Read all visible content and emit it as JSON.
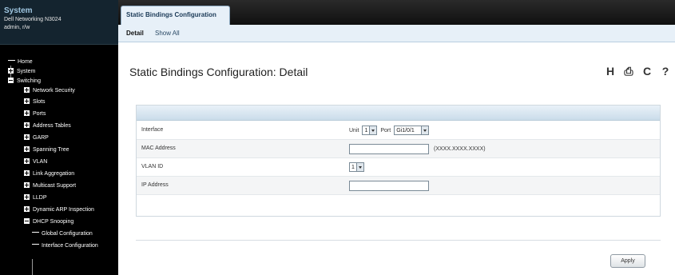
{
  "sidebar": {
    "title": "System",
    "device": "Dell Networking N3024",
    "user": "admin, r/w",
    "tree": [
      {
        "label": "Home",
        "icon": "home-icon"
      },
      {
        "label": "System",
        "icon": "expand-plus-icon"
      },
      {
        "label": "Switching",
        "icon": "collapse-minus-icon"
      },
      {
        "label": "Network Security",
        "icon": "expand-plus-icon"
      },
      {
        "label": "Slots",
        "icon": "expand-plus-icon"
      },
      {
        "label": "Ports",
        "icon": "expand-plus-icon"
      },
      {
        "label": "Address Tables",
        "icon": "expand-plus-icon"
      },
      {
        "label": "GARP",
        "icon": "expand-plus-icon"
      },
      {
        "label": "Spanning Tree",
        "icon": "expand-plus-icon"
      },
      {
        "label": "VLAN",
        "icon": "expand-plus-icon"
      },
      {
        "label": "Link Aggregation",
        "icon": "expand-plus-icon"
      },
      {
        "label": "Multicast Support",
        "icon": "expand-plus-icon"
      },
      {
        "label": "LLDP",
        "icon": "expand-plus-icon"
      },
      {
        "label": "Dynamic ARP Inspection",
        "icon": "expand-plus-icon"
      },
      {
        "label": "DHCP Snooping",
        "icon": "collapse-minus-icon"
      },
      {
        "label": "Global Configuration",
        "icon": "tree-branch"
      },
      {
        "label": "Interface Configuration",
        "icon": "tree-branch"
      }
    ]
  },
  "tabs": {
    "active_tab": "Static Bindings Configuration",
    "subtabs": [
      "Detail",
      "Show All"
    ]
  },
  "main": {
    "title": "Static Bindings Configuration: Detail",
    "toolbar_icons": [
      "save-icon",
      "print-icon",
      "refresh-icon",
      "help-icon"
    ],
    "toolbar_glyphs": [
      "H",
      "⎙",
      "C",
      "?"
    ],
    "form": {
      "interface": {
        "label": "Interface",
        "unit_label": "Unit",
        "unit_value": "1",
        "port_label": "Port",
        "port_value": "Gi1/0/1"
      },
      "mac": {
        "label": "MAC Address",
        "value": "",
        "hint": "(XXXX.XXXX.XXXX)"
      },
      "vlan": {
        "label": "VLAN ID",
        "value": "1"
      },
      "ip": {
        "label": "IP Address",
        "value": ""
      }
    },
    "apply_label": "Apply"
  },
  "colors": {
    "sidebar_bg": "#000000",
    "header_title": "#9fc6e0",
    "tab_bg": "#e7f0f8",
    "panel_header": "#cadcea"
  }
}
